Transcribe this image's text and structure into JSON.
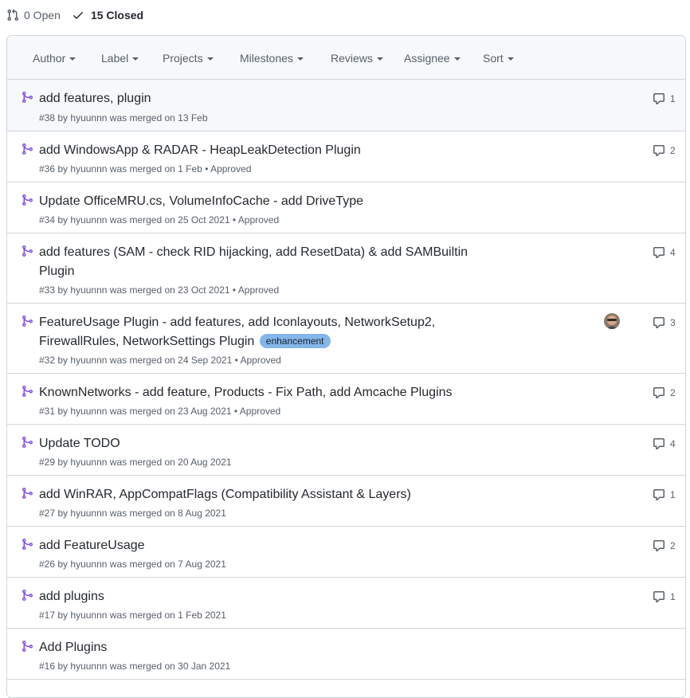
{
  "states": {
    "open_label": "0 Open",
    "closed_label": "15 Closed"
  },
  "filters": [
    "Author",
    "Label",
    "Projects",
    "Milestones",
    "Reviews",
    "Assignee",
    "Sort"
  ],
  "pull_requests": [
    {
      "title": "add features, plugin",
      "number": "#38",
      "by": "by",
      "author": "hyuunnn",
      "merged": "was merged on 13 Feb",
      "review": "",
      "comments": "1"
    },
    {
      "title": "add WindowsApp & RADAR - HeapLeakDetection Plugin",
      "number": "#36",
      "by": "by",
      "author": "hyuunnn",
      "merged": "was merged on 1 Feb",
      "review": "• Approved",
      "comments": "2"
    },
    {
      "title": "Update OfficeMRU.cs, VolumeInfoCache - add DriveType",
      "number": "#34",
      "by": "by",
      "author": "hyuunnn",
      "merged": "was merged on 25 Oct 2021",
      "review": "• Approved",
      "comments": ""
    },
    {
      "title": "add features (SAM - check RID hijacking, add ResetData) & add SAMBuiltin Plugin",
      "number": "#33",
      "by": "by",
      "author": "hyuunnn",
      "merged": "was merged on 23 Oct 2021",
      "review": "• Approved",
      "comments": "4"
    },
    {
      "title": "FeatureUsage Plugin - add features, add Iconlayouts, NetworkSetup2, FirewallRules, NetworkSettings Plugin",
      "label": "enhancement",
      "number": "#32",
      "by": "by",
      "author": "hyuunnn",
      "merged": "was merged on 24 Sep 2021",
      "review": "• Approved",
      "comments": "3",
      "assignee_avatar": "avatar"
    },
    {
      "title": "KnownNetworks - add feature, Products - Fix Path, add Amcache Plugins",
      "number": "#31",
      "by": "by",
      "author": "hyuunnn",
      "merged": "was merged on 23 Aug 2021",
      "review": "• Approved",
      "comments": "2"
    },
    {
      "title": "Update TODO",
      "number": "#29",
      "by": "by",
      "author": "hyuunnn",
      "merged": "was merged on 20 Aug 2021",
      "review": "",
      "comments": "4"
    },
    {
      "title": "add WinRAR, AppCompatFlags (Compatibility Assistant & Layers)",
      "number": "#27",
      "by": "by",
      "author": "hyuunnn",
      "merged": "was merged on 8 Aug 2021",
      "review": "",
      "comments": "1"
    },
    {
      "title": "add FeatureUsage",
      "number": "#26",
      "by": "by",
      "author": "hyuunnn",
      "merged": "was merged on 7 Aug 2021",
      "review": "",
      "comments": "2"
    },
    {
      "title": "add plugins",
      "number": "#17",
      "by": "by",
      "author": "hyuunnn",
      "merged": "was merged on 1 Feb 2021",
      "review": "",
      "comments": "1"
    },
    {
      "title": "Add Plugins",
      "number": "#16",
      "by": "by",
      "author": "hyuunnn",
      "merged": "was merged on 30 Jan 2021",
      "review": "",
      "comments": ""
    }
  ],
  "colors": {
    "merged_icon": "#8250df",
    "label_enhancement": "#84b6eb",
    "border": "#d0d7de",
    "header_bg": "#f6f8fa"
  },
  "icons": {
    "open_state": "git-pull-request-icon",
    "closed_state": "check-icon",
    "row_state": "git-merge-icon",
    "comments": "comment-icon"
  }
}
